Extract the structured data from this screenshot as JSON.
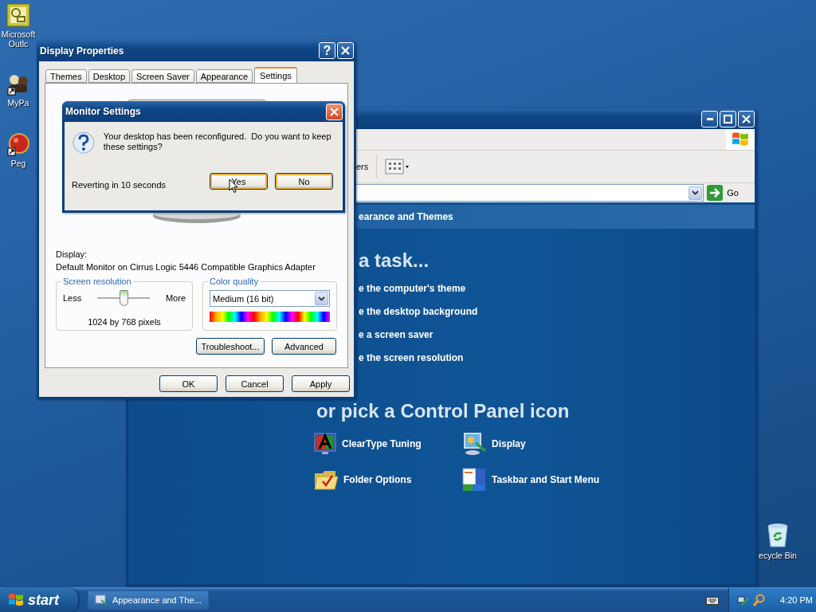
{
  "desktop_icons": [
    {
      "label": "Microsoft Outlc",
      "kind": "calendar"
    },
    {
      "label": "MyPa",
      "kind": "people"
    },
    {
      "label": "Peg",
      "kind": "ball"
    },
    {
      "label": "ecycle Bin",
      "kind": "recycle"
    }
  ],
  "control_panel": {
    "toolbar_text": "ers",
    "go": "Go",
    "header": "earance and Themes",
    "task_heading": "a task...",
    "tasks": [
      "e the computer's theme",
      "e the desktop background",
      "e a screen saver",
      "e the screen resolution"
    ],
    "icon_heading": "or pick a Control Panel icon",
    "icons": [
      {
        "label": "ClearType Tuning",
        "kind": "cleartype"
      },
      {
        "label": "Display",
        "kind": "display"
      },
      {
        "label": "Folder Options",
        "kind": "folder"
      },
      {
        "label": "Taskbar and Start Menu",
        "kind": "taskbar"
      }
    ]
  },
  "display_properties": {
    "title": "Display Properties",
    "help": "?",
    "tabs": [
      {
        "label": "Themes",
        "selected": false
      },
      {
        "label": "Desktop",
        "selected": false
      },
      {
        "label": "Screen Saver",
        "selected": false
      },
      {
        "label": "Appearance",
        "selected": false
      },
      {
        "label": "Settings",
        "selected": true
      }
    ],
    "display_label": "Display:",
    "adapter": "Default Monitor on Cirrus Logic 5446 Compatible Graphics Adapter",
    "resolution": {
      "title": "Screen resolution",
      "less": "Less",
      "more": "More",
      "level": 0.5,
      "value": "1024 by 768 pixels"
    },
    "color_quality": {
      "title": "Color quality",
      "value": "Medium (16 bit)"
    },
    "panel_buttons": [
      "Troubleshoot...",
      "Advanced"
    ],
    "buttons": [
      "OK",
      "Cancel",
      "Apply"
    ]
  },
  "monitor_dialog": {
    "title": "Monitor Settings",
    "message": "Your desktop has been reconfigured.  Do you want to keep these settings?",
    "countdown": "Reverting in 10 seconds",
    "buttons": [
      "Yes",
      "No"
    ]
  },
  "taskbar": {
    "start": "start",
    "tasks": [
      {
        "label": "Appearance and The...",
        "selected": false
      }
    ],
    "clock": "4:20 PM"
  }
}
